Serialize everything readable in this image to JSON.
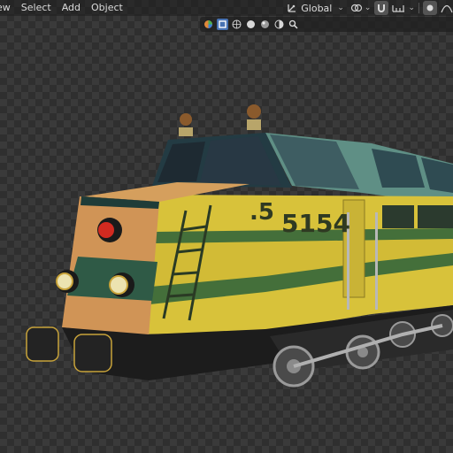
{
  "menu": {
    "items": [
      {
        "label": "ew"
      },
      {
        "label": "Select"
      },
      {
        "label": "Add"
      },
      {
        "label": "Object"
      }
    ]
  },
  "header": {
    "transform_orientation": "Global"
  },
  "model": {
    "number_label": "5154",
    "nose_label": ".5"
  },
  "colors": {
    "yellow": "#d8c23a",
    "green": "#3c6a3a",
    "dark": "#1c1c1c",
    "teal": "#5a8c84",
    "orange": "#d49a5a",
    "accent": "#4772b3"
  }
}
